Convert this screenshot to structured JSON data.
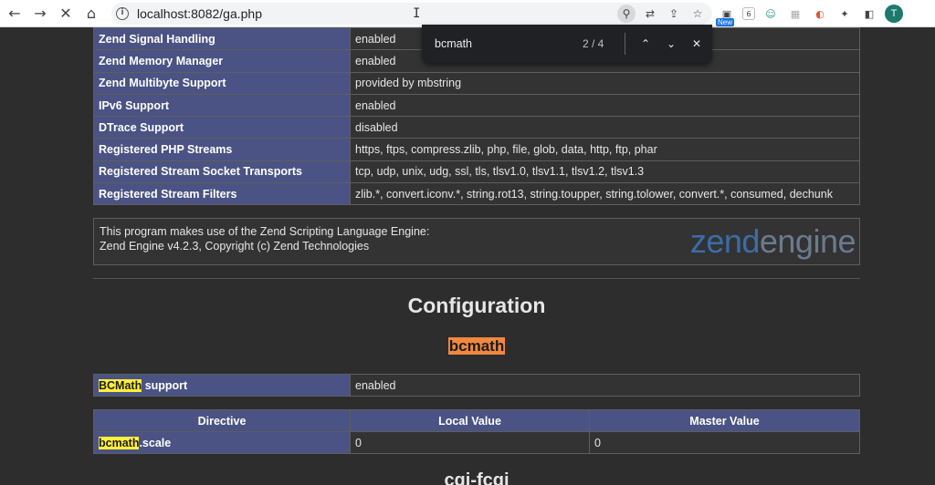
{
  "browser": {
    "url": "localhost:8082/ga.php",
    "new_badge": "New",
    "ext_count": "6",
    "avatar_letter": "T"
  },
  "find_bar": {
    "query": "bcmath",
    "count": "2 / 4"
  },
  "info_rows": [
    {
      "key": "Zend Signal Handling",
      "value": "enabled"
    },
    {
      "key": "Zend Memory Manager",
      "value": "enabled"
    },
    {
      "key": "Zend Multibyte Support",
      "value": "provided by mbstring"
    },
    {
      "key": "IPv6 Support",
      "value": "enabled"
    },
    {
      "key": "DTrace Support",
      "value": "disabled"
    },
    {
      "key": "Registered PHP Streams",
      "value": "https, ftps, compress.zlib, php, file, glob, data, http, ftp, phar"
    },
    {
      "key": "Registered Stream Socket Transports",
      "value": "tcp, udp, unix, udg, ssl, tls, tlsv1.0, tlsv1.1, tlsv1.2, tlsv1.3"
    },
    {
      "key": "Registered Stream Filters",
      "value": "zlib.*, convert.iconv.*, string.rot13, string.toupper, string.tolower, convert.*, consumed, dechunk"
    }
  ],
  "zend": {
    "line1": "This program makes use of the Zend Scripting Language Engine:",
    "line2": "Zend Engine v4.2.3, Copyright (c) Zend Technologies",
    "logo_part1": "zend",
    "logo_part2": "engine"
  },
  "configuration_heading": "Configuration",
  "module_heading": "bcmath",
  "support_row": {
    "key_highlight": "BCMath",
    "key_rest": " support",
    "value": "enabled"
  },
  "directive_table": {
    "headers": [
      "Directive",
      "Local Value",
      "Master Value"
    ],
    "rows": [
      {
        "directive_highlight": "bcmath",
        "directive_rest": ".scale",
        "local": "0",
        "master": "0"
      }
    ]
  },
  "next_heading": "cgi-fcgi",
  "colors": {
    "header_bg": "#4a5383",
    "value_bg": "#333333",
    "current_match": "#f0883e",
    "match": "#ffef3a"
  }
}
